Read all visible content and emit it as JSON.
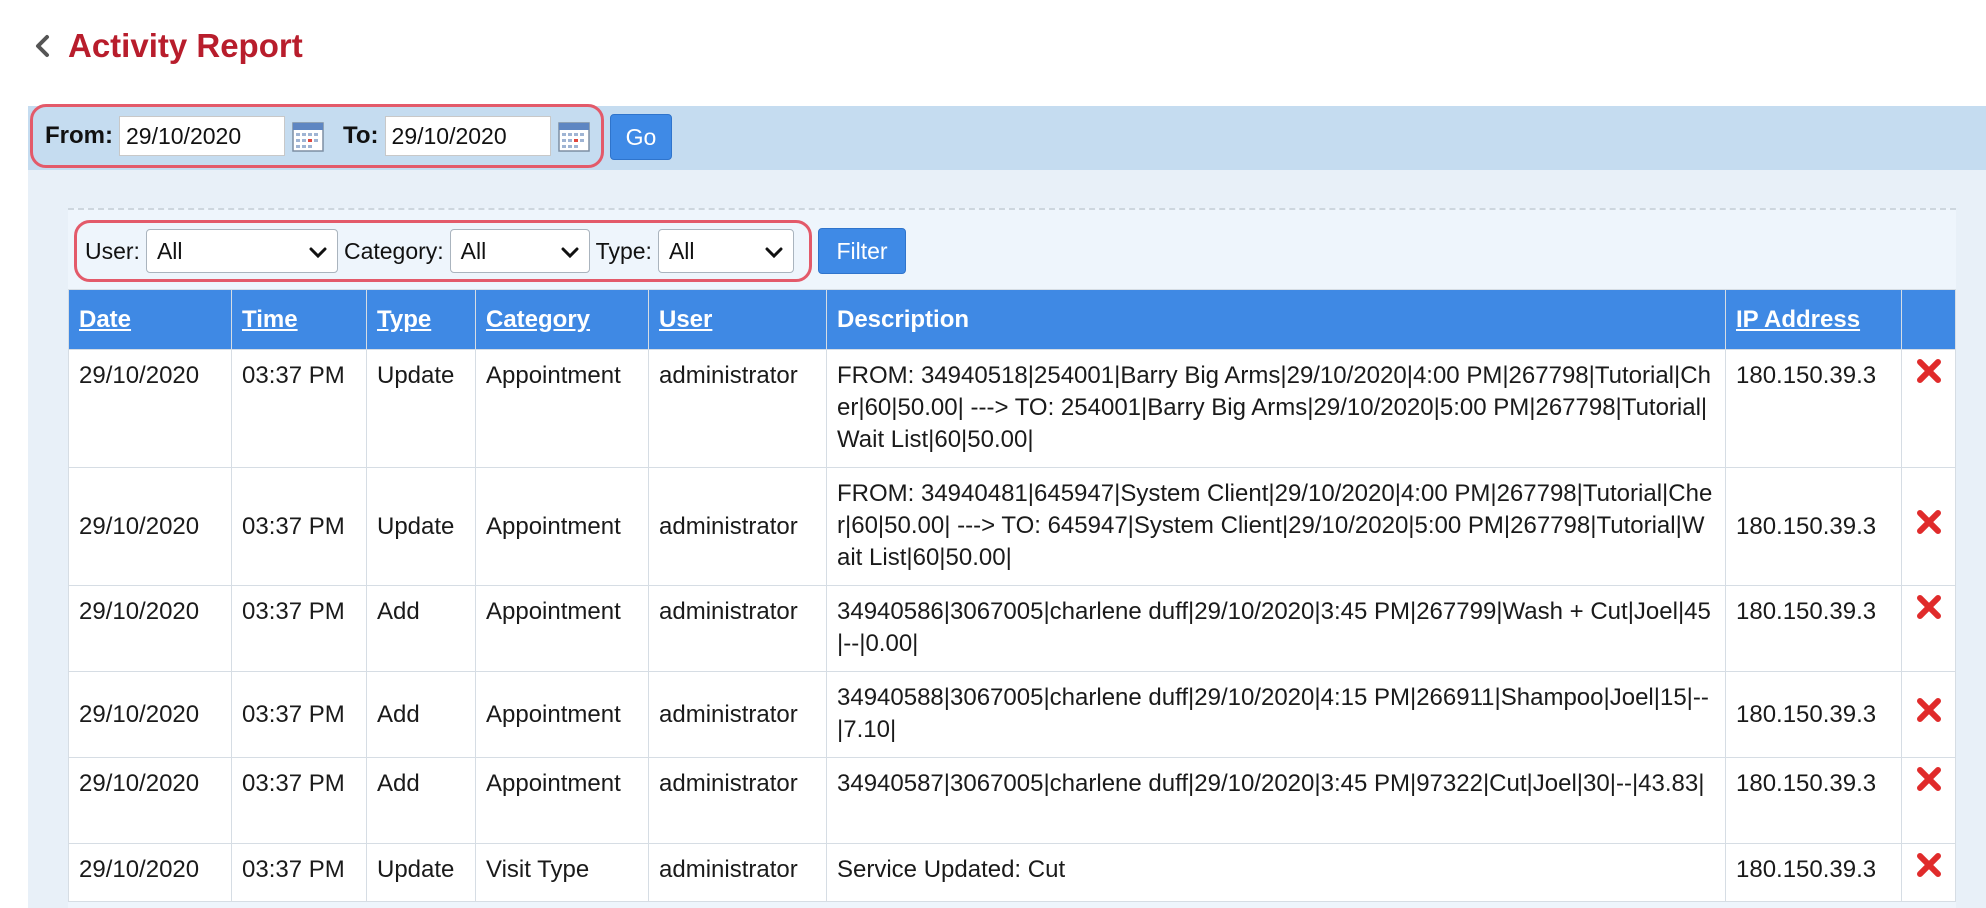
{
  "header": {
    "title": "Activity Report",
    "back_icon": "chevron-left-icon"
  },
  "date_filter": {
    "from_label": "From:",
    "from_value": "29/10/2020",
    "to_label": "To:",
    "to_value": "29/10/2020",
    "go_label": "Go",
    "calendar_icon": "calendar-icon"
  },
  "filters": {
    "user_label": "User:",
    "user_value": "All",
    "category_label": "Category:",
    "category_value": "All",
    "type_label": "Type:",
    "type_value": "All",
    "filter_label": "Filter"
  },
  "table": {
    "columns": [
      "Date",
      "Time",
      "Type",
      "Category",
      "User",
      "Description",
      "IP Address",
      ""
    ],
    "rows": [
      {
        "date": "29/10/2020",
        "time": "03:37 PM",
        "type": "Update",
        "category": "Appointment",
        "user": "administrator",
        "description": "FROM: 34940518|254001|Barry Big Arms|29/10/2020|4:00 PM|267798|Tutorial|Cher|60|50.00| ---> TO: 254001|Barry Big Arms|29/10/2020|5:00 PM|267798|Tutorial|Wait List|60|50.00|",
        "ip": "180.150.39.3"
      },
      {
        "date": "29/10/2020",
        "time": "03:37 PM",
        "type": "Update",
        "category": "Appointment",
        "user": "administrator",
        "description": "FROM: 34940481|645947|System Client|29/10/2020|4:00 PM|267798|Tutorial|Cher|60|50.00| ---> TO: 645947|System Client|29/10/2020|5:00 PM|267798|Tutorial|Wait List|60|50.00|",
        "ip": "180.150.39.3"
      },
      {
        "date": "29/10/2020",
        "time": "03:37 PM",
        "type": "Add",
        "category": "Appointment",
        "user": "administrator",
        "description": "34940586|3067005|charlene duff|29/10/2020|3:45 PM|267799|Wash + Cut|Joel|45|--|0.00|",
        "ip": "180.150.39.3"
      },
      {
        "date": "29/10/2020",
        "time": "03:37 PM",
        "type": "Add",
        "category": "Appointment",
        "user": "administrator",
        "description": "34940588|3067005|charlene duff|29/10/2020|4:15 PM|266911|Shampoo|Joel|15|--|7.10|",
        "ip": "180.150.39.3"
      },
      {
        "date": "29/10/2020",
        "time": "03:37 PM",
        "type": "Add",
        "category": "Appointment",
        "user": "administrator",
        "description": "34940587|3067005|charlene duff|29/10/2020|3:45 PM|97322|Cut|Joel|30|--|43.83|",
        "ip": "180.150.39.3"
      },
      {
        "date": "29/10/2020",
        "time": "03:37 PM",
        "type": "Update",
        "category": "Visit Type",
        "user": "administrator",
        "description": "Service Updated: Cut",
        "ip": "180.150.39.3"
      }
    ],
    "delete_icon": "delete-x-icon"
  },
  "colors": {
    "title": "#b81d2c",
    "accent": "#3f89e4",
    "highlight": "#e35a6a",
    "delete": "#e02b2b",
    "bar": "#c5dcf0"
  }
}
